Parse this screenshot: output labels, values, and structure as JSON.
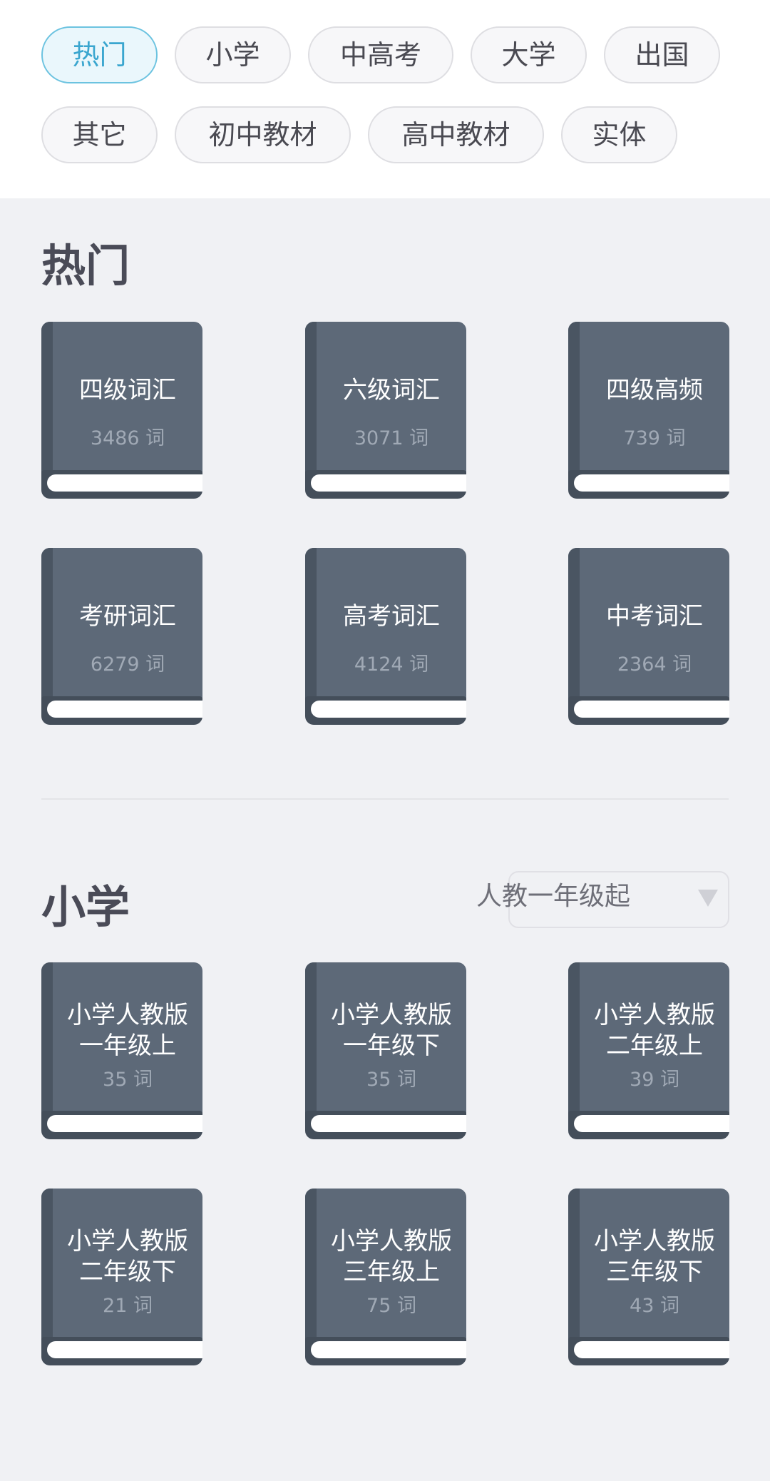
{
  "filters": [
    {
      "label": "热门",
      "active": true
    },
    {
      "label": "小学",
      "active": false
    },
    {
      "label": "中高考",
      "active": false
    },
    {
      "label": "大学",
      "active": false
    },
    {
      "label": "出国",
      "active": false
    },
    {
      "label": "其它",
      "active": false
    },
    {
      "label": "初中教材",
      "active": false
    },
    {
      "label": "高中教材",
      "active": false
    },
    {
      "label": "实体",
      "active": false
    }
  ],
  "hot": {
    "title": "热门",
    "books": [
      {
        "name": "四级词汇",
        "count": "3486 词"
      },
      {
        "name": "六级词汇",
        "count": "3071 词"
      },
      {
        "name": "四级高频",
        "count": "739 词"
      },
      {
        "name": "考研词汇",
        "count": "6279 词"
      },
      {
        "name": "高考词汇",
        "count": "4124 词"
      },
      {
        "name": "中考词汇",
        "count": "2364 词"
      }
    ]
  },
  "primary": {
    "title": "小学",
    "dropdown": {
      "selected": "人教一年级起"
    },
    "books": [
      {
        "name_line1": "小学人教版",
        "name_line2": "一年级上",
        "count": "35 词"
      },
      {
        "name_line1": "小学人教版",
        "name_line2": "一年级下",
        "count": "35 词"
      },
      {
        "name_line1": "小学人教版",
        "name_line2": "二年级上",
        "count": "39 词"
      },
      {
        "name_line1": "小学人教版",
        "name_line2": "二年级下",
        "count": "21 词"
      },
      {
        "name_line1": "小学人教版",
        "name_line2": "三年级上",
        "count": "75 词"
      },
      {
        "name_line1": "小学人教版",
        "name_line2": "三年级下",
        "count": "43 词"
      }
    ]
  }
}
